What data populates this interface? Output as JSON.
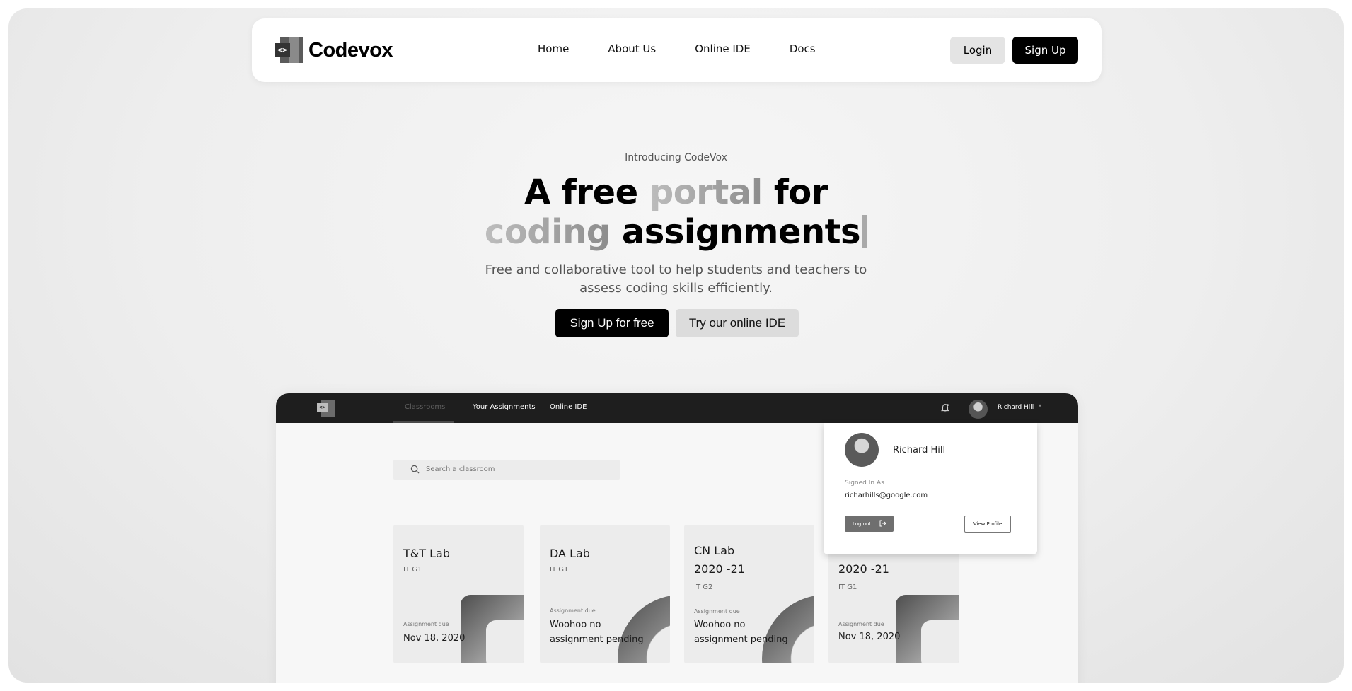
{
  "brand": {
    "name": "Codevox",
    "logo_glyph": "<>"
  },
  "nav": {
    "links": [
      "Home",
      "About Us",
      "Online IDE",
      "Docs"
    ],
    "login_label": "Login",
    "signup_label": "Sign Up"
  },
  "hero": {
    "eyebrow": "Introducing CodeVox",
    "title_part1": "A free ",
    "title_highlight1": "portal",
    "title_part2": " for",
    "title_highlight2": "coding",
    "title_part3": " assignments",
    "subtitle_line1": "Free and collaborative tool to help students and teachers to",
    "subtitle_line2": "assess coding skills efficiently.",
    "cta_primary": "Sign Up for free",
    "cta_secondary": "Try our online IDE"
  },
  "app_preview": {
    "logo_glyph": "<>",
    "tabs": [
      "Classrooms",
      "Your Assignments",
      "Online IDE"
    ],
    "active_tab": "Classrooms",
    "user_name": "Richard Hill",
    "search_placeholder": "Search a classroom",
    "cards": [
      {
        "title": "T&T Lab",
        "section": "IT G1",
        "due_label": "Assignment due",
        "due_value": "Nov 18, 2020"
      },
      {
        "title": "DA Lab",
        "section": "IT G1",
        "due_label": "Assignment due",
        "due_value": "Woohoo no assignment pending"
      },
      {
        "title": "CN Lab 2020 -21",
        "section": "IT G2",
        "due_label": "Assignment due",
        "due_value": "Woohoo no assignment pending"
      },
      {
        "title": "2020 -21",
        "section": "IT G1",
        "due_label": "Assignment due",
        "due_value": "Nov 18, 2020"
      }
    ],
    "profile_popup": {
      "name": "Richard Hill",
      "signed_in_label": "Signed In As",
      "email": "richarhills@google.com",
      "logout_label": "Log out",
      "view_profile_label": "View Profile"
    }
  },
  "colors": {
    "primary": "#000000",
    "secondary_button": "#dcdcdc",
    "app_bar": "#1e1e1e",
    "card_bg": "#ececec"
  },
  "icons": [
    "logo-icon",
    "bell-icon",
    "search-icon",
    "logout-icon",
    "chevron-down-icon",
    "avatar"
  ]
}
